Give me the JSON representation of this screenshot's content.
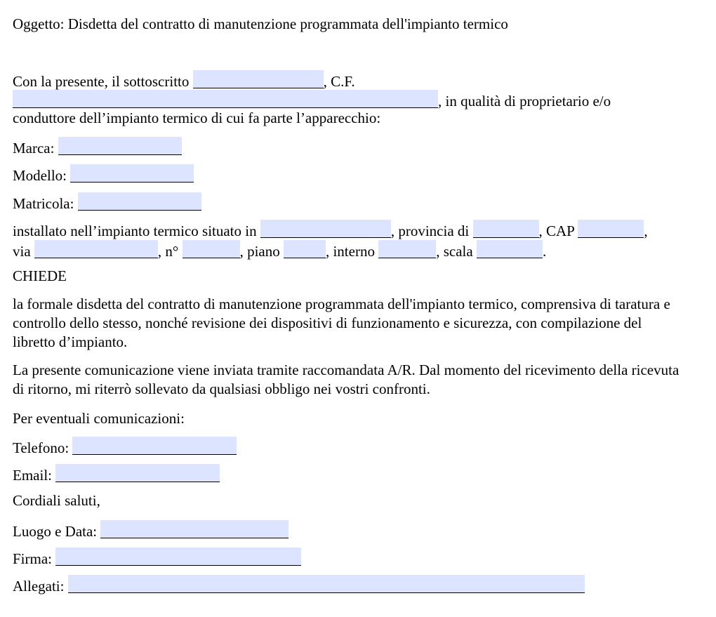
{
  "document": {
    "subject": "Oggetto: Disdetta del contratto di manutenzione programmata dell'impianto termico",
    "intro": {
      "text_before_name": "Con la presente, il sottoscritto",
      "text_after_name": ", C.F.",
      "text_after_cf": ", in qualità di proprietario e/o",
      "line3": "conduttore dell’impianto termico di cui fa parte l’apparecchio:"
    },
    "fields": {
      "sottoscritto": "",
      "codice_fiscale": "",
      "marca": "",
      "modello": "",
      "matricola": "",
      "comune": "",
      "provincia": "",
      "cap": "",
      "via": "",
      "numero": "",
      "piano": "",
      "interno": "",
      "scala": "",
      "telefono": "",
      "email": "",
      "luogo_data": "",
      "firma": "",
      "allegati": ""
    },
    "labels": {
      "marca": "Marca:",
      "modello": "Modello:",
      "matricola": "Matricola:",
      "installato": "installato nell’impianto termico situato in",
      "provincia": ", provincia di",
      "cap": ", CAP",
      "cap_end": ",",
      "via": "via",
      "numero": ", n°",
      "piano": ", piano",
      "interno": ", interno",
      "scala": ", scala",
      "scala_end": ".",
      "telefono": "Telefono:",
      "email": "Email:",
      "luogo_data": "Luogo e Data:",
      "firma": "Firma:",
      "allegati": "Allegati:"
    },
    "chiede": "CHIEDE",
    "request_paragraph": "la formale disdetta del contratto di manutenzione programmata dell'impianto termico, comprensiva di taratura e controllo dello stesso, nonché revisione dei dispositivi di funzionamento e sicurezza, con compilazione del libretto d’impianto.",
    "notice_paragraph": "La presente comunicazione viene inviata tramite raccomandata A/R. Dal momento del ricevimento della ricevuta di ritorno, mi riterrò sollevato da qualsiasi obbligo nei vostri confronti.",
    "contacts_heading": "Per eventuali comunicazioni:",
    "closing": "Cordiali saluti,"
  }
}
